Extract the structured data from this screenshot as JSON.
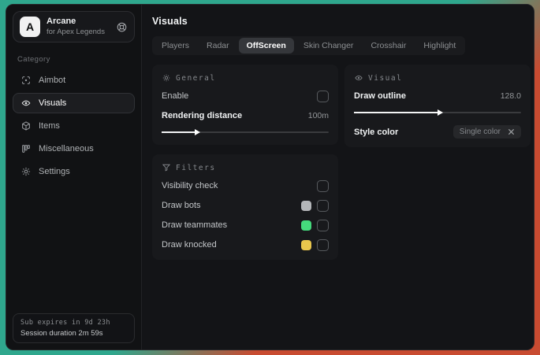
{
  "sidebar": {
    "brand": {
      "logo_letter": "A",
      "name": "Arcane",
      "subtitle": "for Apex Legends"
    },
    "category_label": "Category",
    "items": [
      {
        "label": "Aimbot",
        "icon": "crosshair-icon",
        "selected": false
      },
      {
        "label": "Visuals",
        "icon": "eye-scan-icon",
        "selected": true
      },
      {
        "label": "Items",
        "icon": "box-icon",
        "selected": false
      },
      {
        "label": "Miscellaneous",
        "icon": "columns-icon",
        "selected": false
      },
      {
        "label": "Settings",
        "icon": "gear-icon",
        "selected": false
      }
    ],
    "footer": {
      "sub_expires": "Sub expires in 9d 23h",
      "session_duration": "Session duration 2m 59s"
    }
  },
  "main": {
    "title": "Visuals",
    "tabs": [
      {
        "label": "Players",
        "selected": false
      },
      {
        "label": "Radar",
        "selected": false
      },
      {
        "label": "OffScreen",
        "selected": true
      },
      {
        "label": "Skin Changer",
        "selected": false
      },
      {
        "label": "Crosshair",
        "selected": false
      },
      {
        "label": "Highlight",
        "selected": false
      }
    ],
    "general": {
      "title": "General",
      "enable_label": "Enable",
      "enable_checked": false,
      "slider": {
        "label": "Rendering distance",
        "value": "100m",
        "percent": 20
      }
    },
    "visual": {
      "title": "Visual",
      "slider": {
        "label": "Draw outline",
        "value": "128.0",
        "percent": 50
      },
      "style_color": {
        "label": "Style color",
        "selected_option": "Single color"
      }
    },
    "filters": {
      "title": "Filters",
      "rows": [
        {
          "label": "Visibility check",
          "swatch": null,
          "checked": false
        },
        {
          "label": "Draw bots",
          "swatch": "#b4b6b9",
          "checked": false
        },
        {
          "label": "Draw teammates",
          "swatch": "#45da7c",
          "checked": false
        },
        {
          "label": "Draw knocked",
          "swatch": "#e8c64d",
          "checked": false
        }
      ]
    }
  },
  "colors": {
    "backdrop_teal": "#2fa78d",
    "backdrop_red": "#c84b31",
    "window_bg": "#121316",
    "card_bg": "#18191c",
    "accent_fill": "#f3f4f5"
  }
}
